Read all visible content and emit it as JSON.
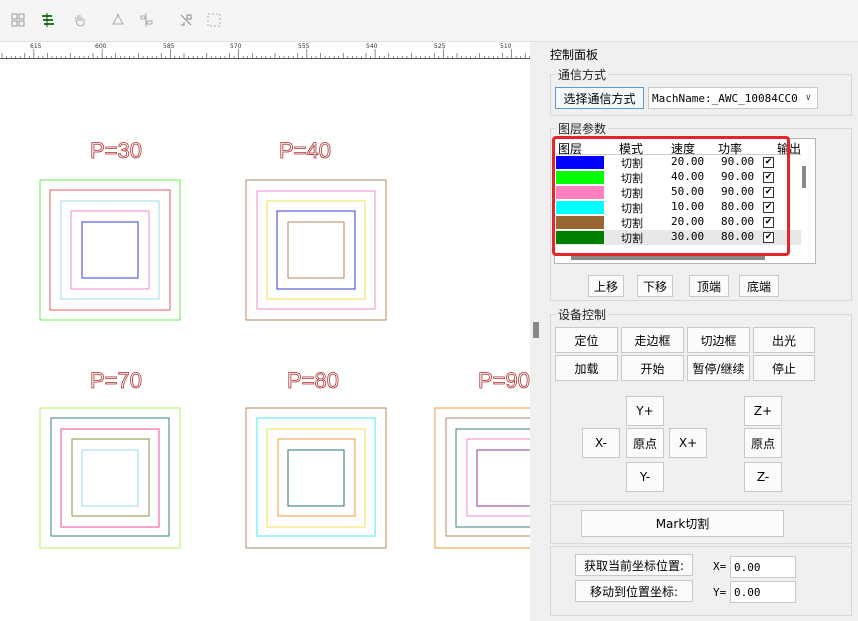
{
  "toolbar": {
    "icons": [
      "grid-icon",
      "layers-icon",
      "hand-icon",
      "node-edit-icon",
      "align-icon",
      "transform-icon",
      "pattern-icon"
    ]
  },
  "ruler": {
    "labels": [
      "615",
      "600",
      "585",
      "570",
      "555",
      "540",
      "525",
      "510"
    ]
  },
  "drawing": {
    "labels": [
      "P=30",
      "P=40",
      "P=70",
      "P=80",
      "P=90"
    ]
  },
  "colors": {
    "blue": "#0000ff",
    "green": "#00ff00",
    "pink": "#ff80c0",
    "cyan": "#00ffff",
    "brown": "#996633",
    "darkgreen": "#008000",
    "highlight": "#e8232a"
  },
  "panel": {
    "title": "控制面板",
    "comm": {
      "group_label": "通信方式",
      "select_button": "选择通信方式",
      "mach_value": "MachName:_AWC_10084CC0"
    },
    "layers": {
      "group_label": "图层参数",
      "headers": [
        "图层",
        "模式",
        "速度",
        "功率",
        "输出"
      ],
      "rows": [
        {
          "color": "#0000ff",
          "mode": "切割",
          "speed": "20.00",
          "power": "90.00",
          "output": "✔"
        },
        {
          "color": "#00ff00",
          "mode": "切割",
          "speed": "40.00",
          "power": "90.00",
          "output": "✔"
        },
        {
          "color": "#ff80c0",
          "mode": "切割",
          "speed": "50.00",
          "power": "90.00",
          "output": "✔"
        },
        {
          "color": "#00ffff",
          "mode": "切割",
          "speed": "10.00",
          "power": "80.00",
          "output": "✔"
        },
        {
          "color": "#996633",
          "mode": "切割",
          "speed": "20.00",
          "power": "80.00",
          "output": "✔"
        },
        {
          "color": "#008000",
          "mode": "切割",
          "speed": "30.00",
          "power": "80.00",
          "output": "✔"
        }
      ],
      "move_up": "上移",
      "move_down": "下移",
      "to_top": "顶端",
      "to_bottom": "底端"
    },
    "device": {
      "group_label": "设备控制",
      "locate": "定位",
      "walk_frame": "走边框",
      "cut_frame": "切边框",
      "light": "出光",
      "load": "加载",
      "start": "开始",
      "pause": "暂停/继续",
      "stop": "停止",
      "y_plus": "Y+",
      "y_minus": "Y-",
      "x_plus": "X+",
      "x_minus": "X-",
      "origin": "原点",
      "z_plus": "Z+",
      "z_minus": "Z-",
      "z_origin": "原点"
    },
    "mark": "Mark切割",
    "coords": {
      "get_pos": "获取当前坐标位置:",
      "move_to": "移动到位置坐标:",
      "x_label": "X=",
      "x_value": "0.00",
      "y_label": "Y=",
      "y_value": "0.00"
    }
  }
}
